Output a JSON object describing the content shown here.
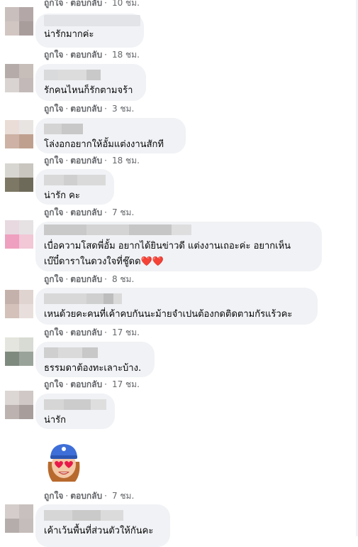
{
  "actions": {
    "like": "ถูกใจ",
    "reply": "ตอบกลับ",
    "dot": "·"
  },
  "comments": [
    {
      "text": "น่ารักมากค่ะ",
      "time": "18 ชม."
    },
    {
      "text": "รักคนไหนก็รักตามจร้า",
      "time": "3 ชม."
    },
    {
      "text": "โล่งอกอยากให้อั้มแต่งงานสักที",
      "time": "18 ชม."
    },
    {
      "text": "น่ารัก คะ",
      "time": "7 ชม."
    },
    {
      "text": "เบื่อความโสดพี่อั้ม อยากได้ยินข่าวดี แต่งงานเถอะค่ะ อยากเห็น\nเบ๊บี๋ดาราในดวงใจที่ชู๊ดด",
      "hearts": "❤️❤️",
      "time": "8 ชม."
    },
    {
      "text": "เหนด้วยคะคนที่เค้าคบกันนะม้ายจำเปนต้องกดติดตามกัรแร้วคะ",
      "time": "17 ชม."
    },
    {
      "text": "ธรรมดาต้องทะเลาะบ้าง.",
      "time": "17 ชม."
    },
    {
      "text": "น่ารัก",
      "time": ""
    },
    {
      "text": "",
      "time": "7 ชม."
    },
    {
      "text": "เค้าเว้นพื้นที่ส่วนตัวให้กันคะ",
      "time": ""
    }
  ],
  "top_time": "10 ชม.",
  "sticker_name": "heart-eyes-emoji-sticker"
}
